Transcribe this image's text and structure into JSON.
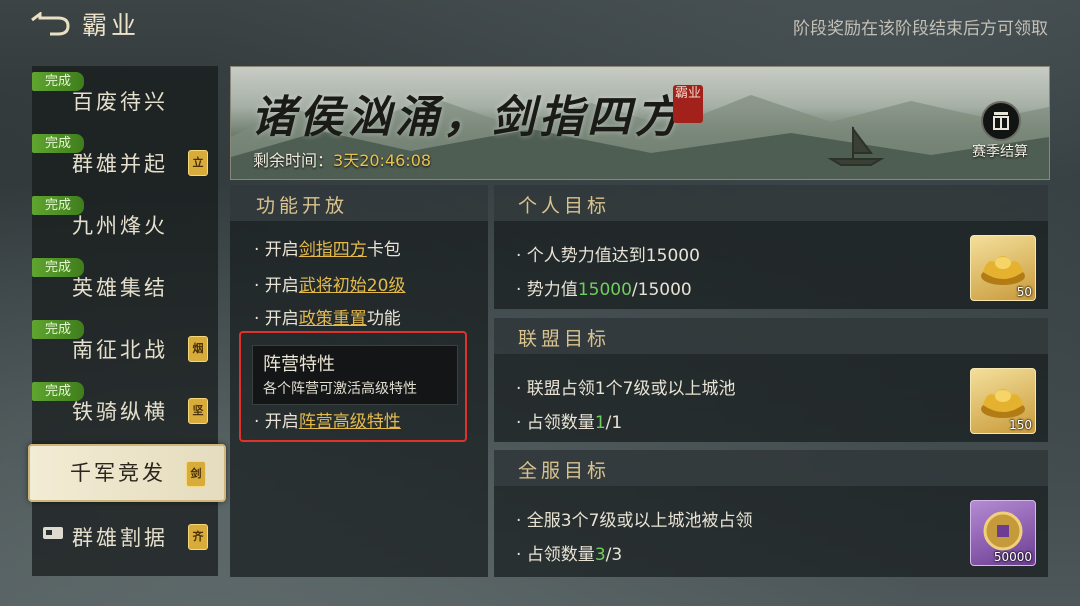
{
  "header": {
    "title": "霸业",
    "notice": "阶段奖励在该阶段结束后方可领取"
  },
  "sidebar": {
    "items": [
      {
        "label": "百废待兴",
        "badge": "完成",
        "chip": ""
      },
      {
        "label": "群雄并起",
        "badge": "完成",
        "chip": "立"
      },
      {
        "label": "九州烽火",
        "badge": "完成",
        "chip": ""
      },
      {
        "label": "英雄集结",
        "badge": "完成",
        "chip": ""
      },
      {
        "label": "南征北战",
        "badge": "完成",
        "chip": "烟"
      },
      {
        "label": "铁骑纵横",
        "badge": "完成",
        "chip": "坚"
      },
      {
        "label": "千军竞发",
        "badge": "",
        "chip": "剑"
      },
      {
        "label": "群雄割据",
        "badge": "",
        "chip": "齐"
      }
    ]
  },
  "banner": {
    "title": "诸侯汹涌，剑指四方",
    "seal": "霸业",
    "timer_label": "剩余时间：",
    "timer_value": "3天20:46:08",
    "settle_label": "赛季结算"
  },
  "functions": {
    "header": "功能开放",
    "items": [
      {
        "prefix": "· 开启",
        "link": "剑指四方",
        "suffix": "卡包"
      },
      {
        "prefix": "· 开启",
        "link": "武将初始20级",
        "suffix": ""
      },
      {
        "prefix": "· 开启",
        "link": "政策重置",
        "suffix": "功能"
      },
      {
        "prefix": "· 开启",
        "link": "阵营高级特性",
        "suffix": ""
      }
    ],
    "tooltip": {
      "title": "阵营特性",
      "desc": "各个阵营可激活高级特性"
    }
  },
  "goals": [
    {
      "header": "个人目标",
      "line1": "· 个人势力值达到15000",
      "line2_prefix": "· 势力值",
      "line2_value": "15000",
      "line2_suffix": "/15000",
      "reward_count": "50",
      "reward_icon": "gold-ingot-icon"
    },
    {
      "header": "联盟目标",
      "line1": "· 联盟占领1个7级或以上城池",
      "line2_prefix": "· 占领数量",
      "line2_value": "1",
      "line2_suffix": "/1",
      "reward_count": "150",
      "reward_icon": "gold-ingot-icon"
    },
    {
      "header": "全服目标",
      "line1": "· 全服3个7级或以上城池被占领",
      "line2_prefix": "· 占领数量",
      "line2_value": "3",
      "line2_suffix": "/3",
      "reward_count": "50000",
      "reward_icon": "coin-icon"
    }
  ],
  "colors": {
    "accent_gold": "#e4b94c",
    "complete_green": "#5fa52f",
    "progress_green": "#6fcf5c",
    "highlight_red": "#e0322d"
  }
}
